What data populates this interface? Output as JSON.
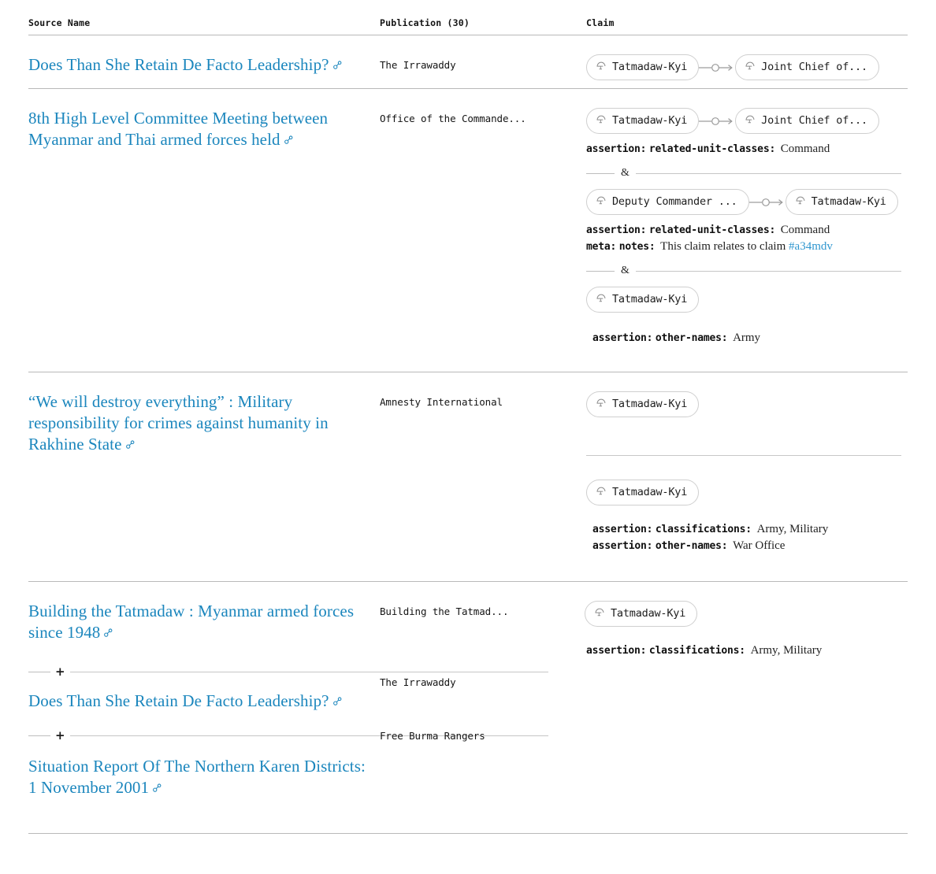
{
  "table": {
    "columns": [
      {
        "id": "source_name",
        "label": "Source Name"
      },
      {
        "id": "publication",
        "label": "Publication (30)"
      },
      {
        "id": "claim",
        "label": "Claim"
      }
    ],
    "link_color": "#1b86bd",
    "entity_icon": "military-helmet-icon",
    "anchor_icon": "permalink-icon",
    "rows": [
      {
        "source_title": "Does Than She Retain De Facto Leadership?",
        "publication": "The Irrawaddy",
        "claim_groups": [
          {
            "chips": [
              {
                "label": "Tatmadaw-Kyi"
              },
              {
                "label": "Joint Chief of..."
              }
            ],
            "connector": "arrow-with-node",
            "assertions": []
          }
        ],
        "sub_sources": []
      },
      {
        "source_title": "8th High Level Committee Meeting between Myanmar and Thai armed forces held",
        "publication": "Office of the Commande...",
        "claim_groups": [
          {
            "chips": [
              {
                "label": "Tatmadaw-Kyi"
              },
              {
                "label": "Joint Chief of..."
              }
            ],
            "connector": "arrow-with-node",
            "assertions": [
              {
                "kind": "assertion:",
                "key": "related-unit-classes:",
                "value": "Command"
              }
            ],
            "join": "&"
          },
          {
            "chips": [
              {
                "label": "Deputy Commander ..."
              },
              {
                "label": "Tatmadaw-Kyi"
              }
            ],
            "connector": "arrow-with-node",
            "assertions": [
              {
                "kind": "assertion:",
                "key": "related-unit-classes:",
                "value": "Command"
              },
              {
                "kind": "meta:",
                "key": "notes:",
                "value": "This claim relates to claim ",
                "link_text": "#a34mdv"
              }
            ],
            "join": "&"
          },
          {
            "chips": [
              {
                "label": "Tatmadaw-Kyi"
              }
            ],
            "connector": "none",
            "indent_assertions": true,
            "assertions": [
              {
                "kind": "assertion:",
                "key": "other-names:",
                "value": "Army"
              }
            ]
          }
        ],
        "sub_sources": []
      },
      {
        "source_title": "“We will destroy everything” : Military responsibility for crimes against humanity in Rakhine State",
        "publication": "Amnesty International",
        "claim_groups": [
          {
            "chips": [
              {
                "label": "Tatmadaw-Kyi"
              }
            ],
            "connector": "none",
            "assertions": [],
            "separator_after": true
          },
          {
            "chips": [
              {
                "label": "Tatmadaw-Kyi"
              }
            ],
            "connector": "none",
            "indent_assertions": true,
            "assertions": [
              {
                "kind": "assertion:",
                "key": "classifications:",
                "value": "Army, Military"
              },
              {
                "kind": "assertion:",
                "key": "other-names:",
                "value": "War Office"
              }
            ]
          }
        ],
        "sub_sources": []
      },
      {
        "source_title": "Building the Tatmadaw : Myanmar armed forces since 1948",
        "publication": "Building the Tatmad...",
        "claim_groups": [
          {
            "chips": [
              {
                "label": "Tatmadaw-Kyi"
              }
            ],
            "connector": "none",
            "assertions": [
              {
                "kind": "assertion:",
                "key": "classifications:",
                "value": "Army, Military"
              }
            ]
          }
        ],
        "sub_sources": [
          {
            "expander": "+",
            "source_title": "Does Than She Retain De Facto Leadership?",
            "publication": "The Irrawaddy"
          },
          {
            "expander": "+",
            "source_title": "Situation Report Of The Northern Karen Districts: 1 November 2001",
            "publication": "Free Burma Rangers"
          }
        ]
      }
    ]
  }
}
